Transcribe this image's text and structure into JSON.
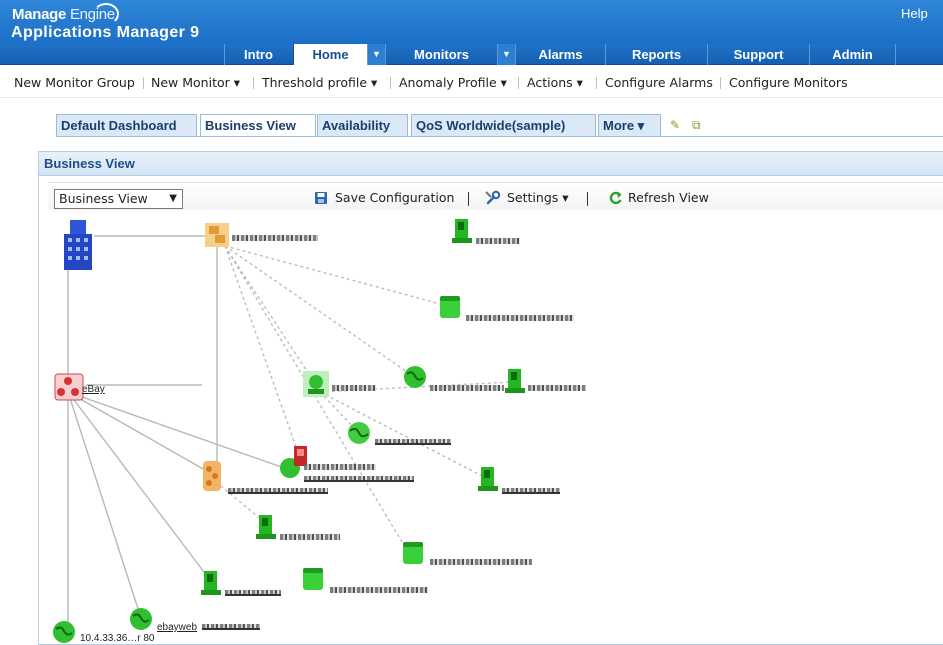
{
  "app": {
    "brand_top": "Manage",
    "brand_top_2": "Engine",
    "brand_main": "Applications Manager 9",
    "help": "Help"
  },
  "nav": {
    "items": [
      {
        "label": "Intro"
      },
      {
        "label": "Home"
      },
      {
        "label": "Monitors"
      },
      {
        "label": "Alarms"
      },
      {
        "label": "Reports"
      },
      {
        "label": "Support"
      },
      {
        "label": "Admin"
      }
    ],
    "caret": "▼"
  },
  "submenu": {
    "items": [
      {
        "label": "New Monitor Group"
      },
      {
        "label": "New Monitor ▾"
      },
      {
        "label": "Threshold profile ▾"
      },
      {
        "label": "Anomaly Profile ▾"
      },
      {
        "label": "Actions ▾"
      },
      {
        "label": "Configure Alarms"
      },
      {
        "label": "Configure Monitors"
      }
    ]
  },
  "tabs": {
    "items": [
      {
        "label": "Default Dashboard"
      },
      {
        "label": "Business View"
      },
      {
        "label": "Availability"
      },
      {
        "label": "QoS Worldwide(sample)"
      },
      {
        "label": "More ▾"
      }
    ],
    "active": "Business View",
    "edit_icon": "✎",
    "popout_icon": "⧉"
  },
  "panel": {
    "title": "Business View"
  },
  "toolbar": {
    "view_selected": "Business View",
    "view_caret": "▼",
    "save": "Save Configuration",
    "settings": "Settings ▾",
    "refresh": "Refresh View",
    "save_icon": "floppy-disk-icon",
    "settings_icon": "wrench-icon",
    "refresh_icon": "refresh-icon"
  },
  "graph": {
    "labels": {
      "ebay": "eBay",
      "ip_node": "10.4.33.36…r 80",
      "ebayweb": "ebayweb"
    },
    "colors": {
      "ok": "#2fb52f",
      "critical": "#d93232",
      "group": "#f0a040",
      "link": "#b0b0b0"
    }
  }
}
